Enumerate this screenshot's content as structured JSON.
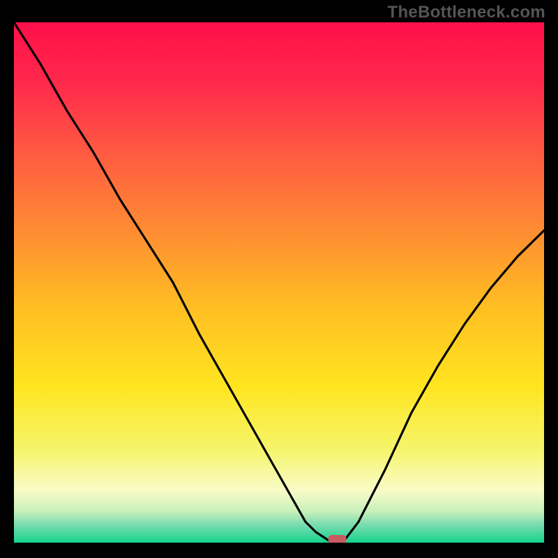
{
  "watermark": "TheBottleneck.com",
  "chart_data": {
    "type": "line",
    "title": "",
    "xlabel": "",
    "ylabel": "",
    "xlim": [
      0,
      100
    ],
    "ylim": [
      0,
      100
    ],
    "x": [
      0,
      5,
      10,
      15,
      20,
      25,
      30,
      35,
      40,
      45,
      50,
      55,
      57,
      60,
      62,
      65,
      70,
      75,
      80,
      85,
      90,
      95,
      100
    ],
    "values": [
      100,
      92,
      83,
      75,
      66,
      58,
      50,
      40,
      31,
      22,
      13,
      4,
      2,
      0,
      0,
      4,
      14,
      25,
      34,
      42,
      49,
      55,
      60
    ],
    "marker": {
      "x": 61,
      "y": 0
    },
    "gradient_stops": [
      {
        "offset": 0.0,
        "color": "#ff0f4a"
      },
      {
        "offset": 0.12,
        "color": "#ff2a4b"
      },
      {
        "offset": 0.25,
        "color": "#ff5a42"
      },
      {
        "offset": 0.4,
        "color": "#ff8c33"
      },
      {
        "offset": 0.55,
        "color": "#ffbf22"
      },
      {
        "offset": 0.7,
        "color": "#ffe520"
      },
      {
        "offset": 0.82,
        "color": "#f5f56a"
      },
      {
        "offset": 0.9,
        "color": "#f9fbc7"
      },
      {
        "offset": 0.94,
        "color": "#c8f0bb"
      },
      {
        "offset": 0.965,
        "color": "#7bdcb0"
      },
      {
        "offset": 1.0,
        "color": "#16d38e"
      }
    ]
  }
}
